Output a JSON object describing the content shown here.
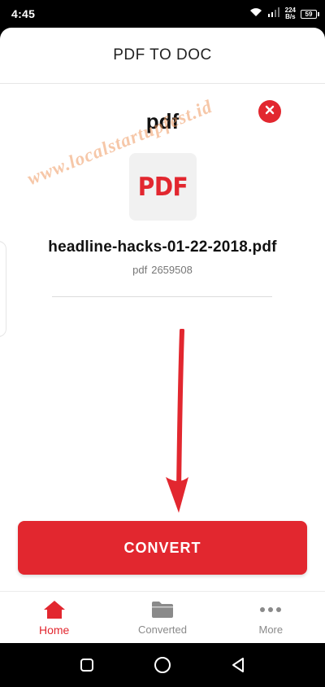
{
  "status_bar": {
    "time": "4:45",
    "speed_value": "224",
    "speed_unit": "B/s",
    "battery": "59"
  },
  "header": {
    "title": "PDF TO DOC"
  },
  "file": {
    "type_heading": "pdf",
    "thumbnail_label": "PDF",
    "name": "headline-hacks-01-22-2018.pdf",
    "meta_type": "pdf",
    "meta_size": "2659508"
  },
  "actions": {
    "convert_label": "CONVERT"
  },
  "bottom_nav": {
    "items": [
      {
        "label": "Home",
        "icon": "home-icon",
        "active": true
      },
      {
        "label": "Converted",
        "icon": "folder-icon",
        "active": false
      },
      {
        "label": "More",
        "icon": "more-icon",
        "active": false
      }
    ]
  },
  "watermark": "www.localstartupfest.id",
  "colors": {
    "accent": "#e2272f",
    "annotation_arrow": "#e2272f"
  }
}
